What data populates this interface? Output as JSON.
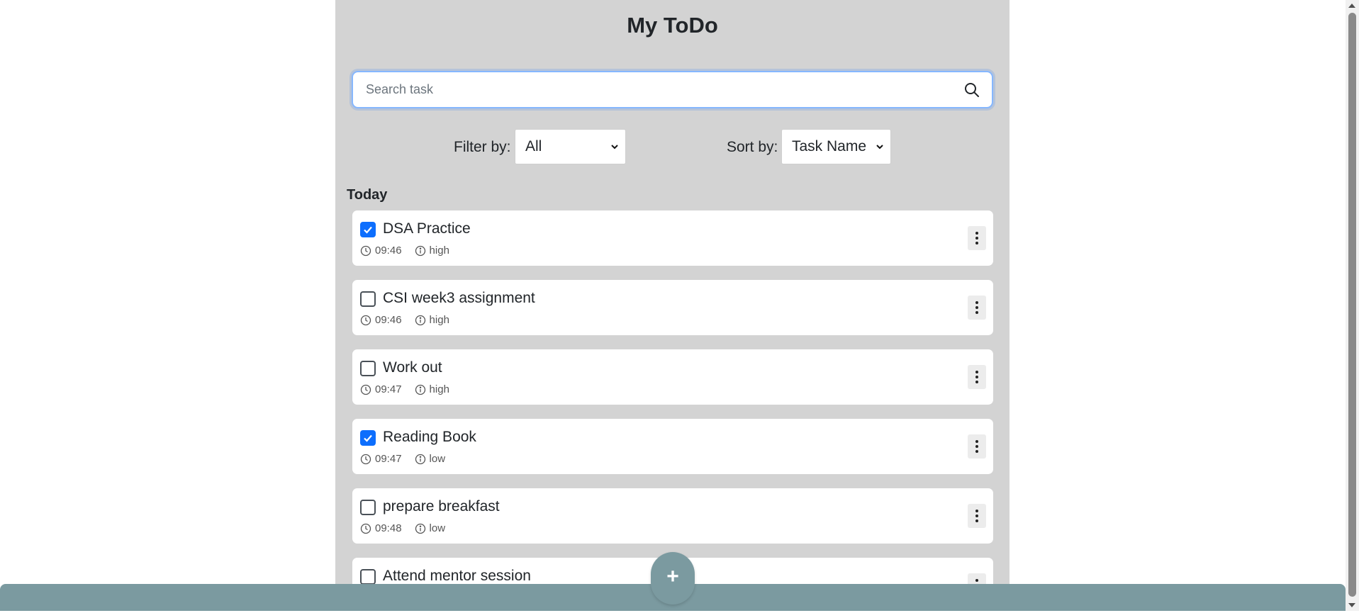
{
  "app": {
    "title": "My ToDo"
  },
  "search": {
    "placeholder": "Search task",
    "value": "",
    "icon": "search-icon"
  },
  "filter": {
    "label": "Filter by:",
    "selected": "All"
  },
  "sort": {
    "label": "Sort by:",
    "selected": "Task Name"
  },
  "section": {
    "label": "Today"
  },
  "tasks": [
    {
      "name": "DSA Practice",
      "time": "09:46",
      "priority": "high",
      "done": true
    },
    {
      "name": "CSI week3 assignment",
      "time": "09:46",
      "priority": "high",
      "done": false
    },
    {
      "name": "Work out",
      "time": "09:47",
      "priority": "high",
      "done": false
    },
    {
      "name": "Reading Book",
      "time": "09:47",
      "priority": "low",
      "done": true
    },
    {
      "name": "prepare breakfast",
      "time": "09:48",
      "priority": "low",
      "done": false
    },
    {
      "name": "Attend mentor session",
      "time": "",
      "priority": "",
      "done": false
    }
  ],
  "fab": {
    "label": "+"
  },
  "colors": {
    "panel": "#d3d3d3",
    "accent": "#0d6efd",
    "bar": "#7b9aa0"
  }
}
